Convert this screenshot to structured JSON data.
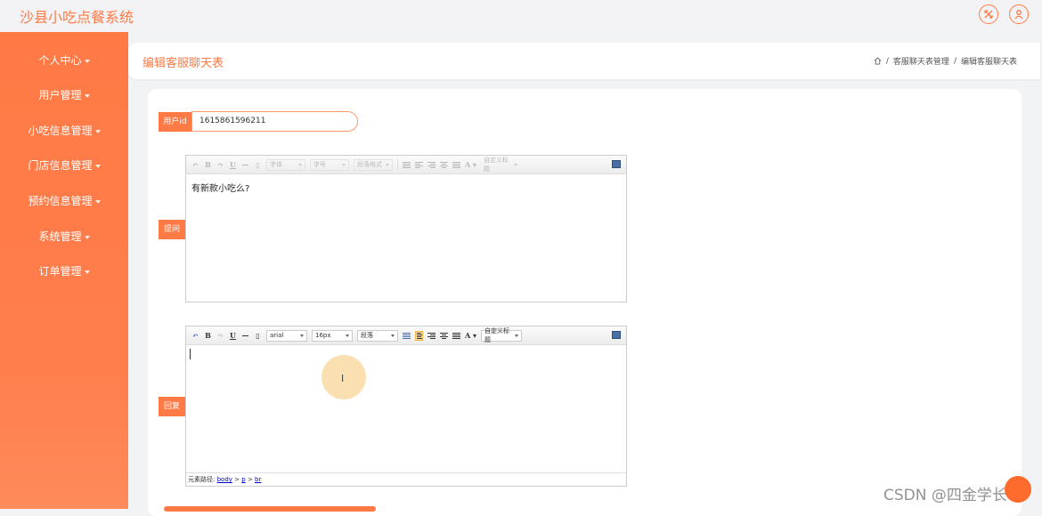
{
  "app": {
    "title": "沙县小吃点餐系统"
  },
  "topbar": {
    "icons": [
      "fullscreen-icon",
      "user-icon"
    ]
  },
  "sidebar": {
    "items": [
      {
        "label": "个人中心"
      },
      {
        "label": "用户管理"
      },
      {
        "label": "小吃信息管理"
      },
      {
        "label": "门店信息管理"
      },
      {
        "label": "预约信息管理"
      },
      {
        "label": "系统管理"
      },
      {
        "label": "订单管理"
      }
    ]
  },
  "header": {
    "page_title": "编辑客服聊天表",
    "breadcrumb": {
      "sep": "/",
      "items": [
        "客服聊天表管理",
        "编辑客服聊天表"
      ]
    }
  },
  "form": {
    "userid": {
      "label": "用户id",
      "value": "1615861596211"
    },
    "question": {
      "label": "提问",
      "content": "有新款小吃么?",
      "toolbar": {
        "font_family": "字体",
        "font_size": "字号",
        "paragraph": "段落格式",
        "custom_title": "自定义标题"
      }
    },
    "reply": {
      "label": "回复",
      "content": "",
      "toolbar": {
        "font_family": "arial",
        "font_size": "16px",
        "paragraph": "段落",
        "custom_title": "自定义标题"
      },
      "element_path": {
        "prefix": "元素路径:",
        "parts": [
          "body",
          "p",
          "br"
        ],
        "sep": ">"
      }
    }
  },
  "watermark": "CSDN @四金学长",
  "colors": {
    "accent": "#ff7a45",
    "sidebar": "#ff7a45",
    "highlight": "#ffe4a6"
  }
}
